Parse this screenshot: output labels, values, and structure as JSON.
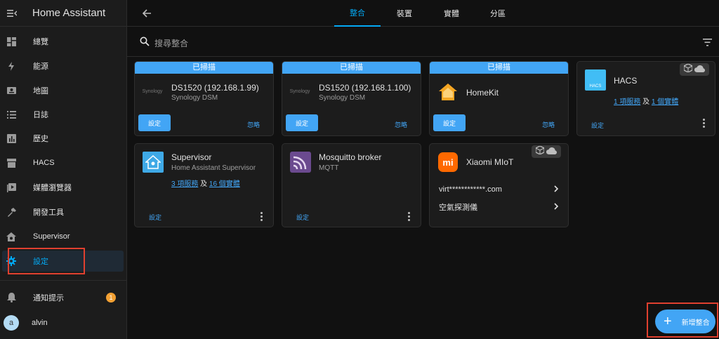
{
  "app": {
    "title": "Home Assistant"
  },
  "sidebar": {
    "items": [
      {
        "label": "總覽",
        "icon": "dashboard-icon"
      },
      {
        "label": "能源",
        "icon": "lightning-icon"
      },
      {
        "label": "地圖",
        "icon": "map-icon"
      },
      {
        "label": "日誌",
        "icon": "logbook-icon"
      },
      {
        "label": "歷史",
        "icon": "history-icon"
      },
      {
        "label": "HACS",
        "icon": "hacs-icon"
      },
      {
        "label": "媒體瀏覽器",
        "icon": "media-icon"
      },
      {
        "label": "開發工具",
        "icon": "hammer-icon"
      },
      {
        "label": "Supervisor",
        "icon": "supervisor-icon"
      },
      {
        "label": "設定",
        "icon": "gear-icon"
      }
    ],
    "notifications": {
      "label": "通知提示",
      "count": "1"
    },
    "user": {
      "initial": "a",
      "name": "alvin"
    }
  },
  "tabs": [
    "整合",
    "裝置",
    "實體",
    "分區"
  ],
  "search": {
    "placeholder": "搜尋整合"
  },
  "cards": {
    "ds1": {
      "banner": "已掃描",
      "logo": "Synology",
      "title": "DS1520 (192.168.1.99)",
      "subtitle": "Synology DSM",
      "configure": "設定",
      "ignore": "忽略"
    },
    "ds2": {
      "banner": "已掃描",
      "logo": "Synology",
      "title": "DS1520 (192.168.1.100)",
      "subtitle": "Synology DSM",
      "configure": "設定",
      "ignore": "忽略"
    },
    "homekit": {
      "banner": "已掃描",
      "title": "HomeKit",
      "configure": "設定",
      "ignore": "忽略"
    },
    "hacs": {
      "logo": "HACS",
      "title": "HACS",
      "link1": "1 項服務",
      "and": "及",
      "link2": "1 個實體",
      "configure": "設定"
    },
    "supervisor": {
      "title": "Supervisor",
      "subtitle": "Home Assistant Supervisor",
      "link1": "3 項服務",
      "and": "及",
      "link2": "16 個實體",
      "configure": "設定"
    },
    "mosquitto": {
      "title": "Mosquitto broker",
      "subtitle": "MQTT",
      "configure": "設定"
    },
    "xiaomi": {
      "logo": "mi",
      "title": "Xiaomi MIoT",
      "entries": [
        "virt************.com",
        "空氣探測儀"
      ]
    }
  },
  "fab": {
    "label": "新增整合"
  },
  "colors": {
    "accent": "#03a9f4",
    "button": "#42a5f5",
    "badge": "#f2a033",
    "highlight_box": "#e0402f",
    "homekit": "#f5a623",
    "xiaomi": "#ff6900"
  }
}
